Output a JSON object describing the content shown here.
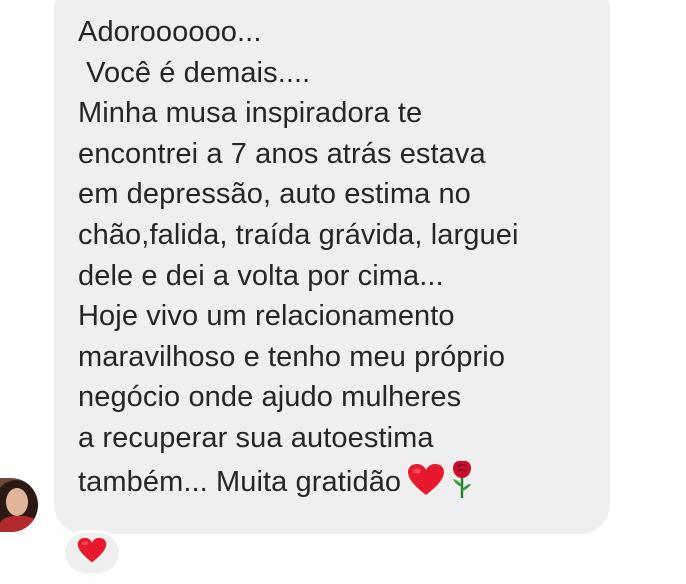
{
  "message": {
    "lines": [
      "Adoroooooo...",
      " Você é demais....",
      "Minha musa inspiradora te",
      "encontrei a 7 anos atrás estava",
      "em depressão, auto estima no",
      "chão,falida, traída grávida, larguei",
      "dele e dei a volta por cima...",
      "Hoje vivo um relacionamento",
      "maravilhoso e tenho meu próprio",
      "negócio onde ajudo mulheres",
      "a recuperar sua autoestima",
      "também... Muita gratidão"
    ],
    "trailing_emojis": [
      "heart-emoji",
      "rose-emoji"
    ]
  },
  "reaction": {
    "emoji": "heart-emoji"
  },
  "colors": {
    "bubble": "#efefef",
    "text": "#262626",
    "heart": "#e8192c",
    "rose": "#c8102e"
  }
}
